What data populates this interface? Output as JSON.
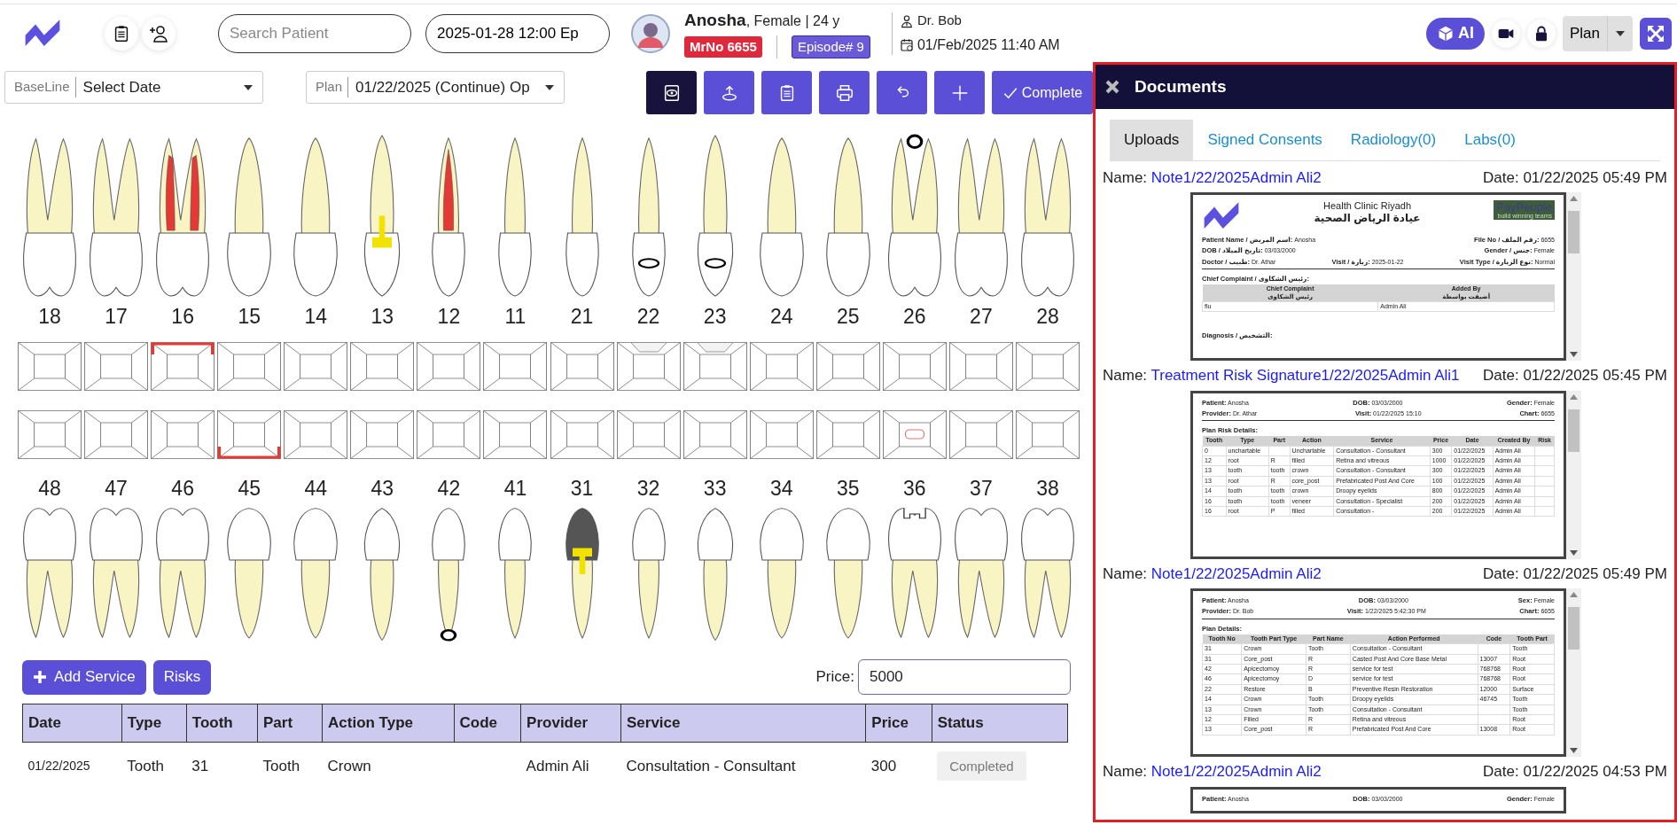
{
  "header": {
    "search": {
      "placeholder": "Search Patient"
    },
    "episode_field": {
      "value": "2025-01-28 12:00 Ep"
    },
    "patient": {
      "name": "Anosha",
      "details": ", Female | 24 y",
      "mrno": "MrNo 6655",
      "episode": "Episode# 9"
    },
    "doctor": "Dr. Bob",
    "visit_time": "01/Feb/2025 11:40 AM",
    "ai_button": "AI",
    "plan_button": "Plan"
  },
  "filters": [
    {
      "label": "BaseLine",
      "value": "Select Date"
    },
    {
      "label": "Plan",
      "value": "01/22/2025 (Continue) Op"
    }
  ],
  "toolbar": [
    {
      "kind": "eye",
      "selected": true
    },
    {
      "kind": "upload",
      "selected": false
    },
    {
      "kind": "clipboard",
      "selected": false
    },
    {
      "kind": "print",
      "selected": false
    },
    {
      "kind": "undo",
      "selected": false
    },
    {
      "kind": "plus",
      "selected": false
    },
    {
      "kind": "complete",
      "label": "Complete",
      "selected": false
    }
  ],
  "upper_teeth": [
    {
      "number": "18",
      "kind": "molar"
    },
    {
      "number": "17",
      "kind": "molar"
    },
    {
      "number": "16",
      "kind": "molar",
      "root_canal": true,
      "surface_top": true
    },
    {
      "number": "15",
      "kind": "premolar"
    },
    {
      "number": "14",
      "kind": "premolar"
    },
    {
      "number": "13",
      "kind": "canine",
      "post": true
    },
    {
      "number": "12",
      "kind": "incisor",
      "root_canal": true
    },
    {
      "number": "11",
      "kind": "incisor"
    },
    {
      "number": "21",
      "kind": "incisor"
    },
    {
      "number": "22",
      "kind": "incisor",
      "restored": true,
      "surface_notch": true
    },
    {
      "number": "23",
      "kind": "canine",
      "restored": true,
      "surface_notch": true
    },
    {
      "number": "24",
      "kind": "premolar"
    },
    {
      "number": "25",
      "kind": "premolar"
    },
    {
      "number": "26",
      "kind": "molar",
      "apex_circle": true
    },
    {
      "number": "27",
      "kind": "molar"
    },
    {
      "number": "28",
      "kind": "molar"
    }
  ],
  "lower_teeth": [
    {
      "number": "48",
      "kind": "molar"
    },
    {
      "number": "47",
      "kind": "molar"
    },
    {
      "number": "46",
      "kind": "molar"
    },
    {
      "number": "45",
      "kind": "premolar",
      "surface_bottom": true
    },
    {
      "number": "44",
      "kind": "premolar"
    },
    {
      "number": "43",
      "kind": "canine"
    },
    {
      "number": "42",
      "kind": "incisor",
      "apex_circle": true
    },
    {
      "number": "41",
      "kind": "incisor"
    },
    {
      "number": "31",
      "kind": "incisor",
      "crown": true,
      "post": true
    },
    {
      "number": "32",
      "kind": "incisor"
    },
    {
      "number": "33",
      "kind": "canine"
    },
    {
      "number": "34",
      "kind": "premolar"
    },
    {
      "number": "35",
      "kind": "premolar"
    },
    {
      "number": "36",
      "kind": "molar",
      "occlusal_restore": true,
      "surface_center": true
    },
    {
      "number": "37",
      "kind": "molar"
    },
    {
      "number": "38",
      "kind": "molar"
    }
  ],
  "service_bar": {
    "add_service": "Add Service",
    "risks": "Risks",
    "price_label": "Price:",
    "price_value": "5000"
  },
  "table": {
    "columns": [
      "Date",
      "Type",
      "Tooth",
      "Part",
      "Action Type",
      "Code",
      "Provider",
      "Service",
      "Price",
      "Status"
    ],
    "rows": [
      [
        "01/22/2025",
        "Tooth",
        "31",
        "Tooth",
        "Crown",
        null,
        "Admin Ali",
        "Consultation - Consultant",
        "300",
        "Completed"
      ]
    ]
  },
  "documents_panel": {
    "title": "Documents",
    "tabs": [
      {
        "label": "Uploads",
        "selected": true
      },
      {
        "label": "Signed Consents",
        "selected": false
      },
      {
        "label": "Radiology(0)",
        "selected": false
      },
      {
        "label": "Labs(0)",
        "selected": false
      }
    ],
    "documents": [
      {
        "name_label": "Name:",
        "name": "Note1/22/2025Admin Ali2",
        "date": "Date: 01/22/2025 05:49 PM",
        "preview": {
          "clinic": {
            "name": "Health Clinic Riyadh",
            "name_ar": "عيادة الرياض الصحية",
            "partner_logo": "PayPeople",
            "partner_tagline": "build winning teams"
          },
          "fields": [
            [
              {
                "label": "Patient Name / اسم المريض:",
                "value": "Anosha"
              },
              {
                "label": "File No / رقم الملف:",
                "value": "6655"
              }
            ],
            [
              {
                "label": "DOB / تاريخ الميلاد:",
                "value": "03/03/2000"
              },
              {
                "label": "Gender / جنس:",
                "value": "Female"
              }
            ],
            [
              {
                "label": "Doctor / طبيب:",
                "value": "Dr. Athar"
              },
              {
                "label": "Visit / زيارة:",
                "value": "2025-01-22"
              },
              {
                "label": "Visit Type / نوع الزيارة:",
                "value": "Normal"
              }
            ]
          ],
          "section": "Chief Complaint / رئيس الشكاوى:",
          "columns": [
            {
              "label": "Chief Complaint",
              "sub": "رئيس الشكاوى"
            },
            {
              "label": "Added By",
              "sub": "أضيفت بواسطة"
            }
          ],
          "rows": [
            [
              "flu",
              "Admin Ali"
            ]
          ],
          "footer_section": "Diagnosis / التشخيص:"
        }
      },
      {
        "name_label": "Name:",
        "name": "Treatment Risk Signature1/22/2025Admin Ali1",
        "date": "Date: 01/22/2025 05:45 PM",
        "preview": {
          "fields": [
            [
              {
                "label": "Patient:",
                "value": "Anosha"
              },
              {
                "label": "DOB:",
                "value": "03/03/2000"
              },
              {
                "label": "Gender:",
                "value": "Female"
              }
            ],
            [
              {
                "label": "Provider:",
                "value": "Dr. Athar"
              },
              {
                "label": "Visit:",
                "value": "01/22/2025 15:10"
              },
              {
                "label": "Chart:",
                "value": "6655"
              }
            ]
          ],
          "section": "Plan Risk Details:",
          "columns": [
            {
              "label": "Tooth"
            },
            {
              "label": "Type"
            },
            {
              "label": "Part"
            },
            {
              "label": "Action"
            },
            {
              "label": "Service"
            },
            {
              "label": "Price"
            },
            {
              "label": "Date"
            },
            {
              "label": "Created By"
            },
            {
              "label": "Risk"
            }
          ],
          "rows": [
            [
              "0",
              "unchartable",
              null,
              "Unchartable",
              "Consultation - Consultant",
              "300",
              "01/22/2025",
              "Admin Ali",
              null
            ],
            [
              "12",
              "root",
              "R",
              "filled",
              "Retina and vitreous",
              "1000",
              "01/22/2025",
              "Admin Ali",
              null
            ],
            [
              "13",
              "tooth",
              "tooth",
              "crown",
              "Consultation - Consultant",
              "300",
              "01/22/2025",
              "Admin Ali",
              null
            ],
            [
              "13",
              "root",
              "R",
              "core_post",
              "Prefabricated Post And Core",
              "100",
              "01/22/2025",
              "Admin Ali",
              null
            ],
            [
              "14",
              "tooth",
              "tooth",
              "crown",
              "Droopy eyelids",
              "800",
              "01/22/2025",
              "Admin Ali",
              null
            ],
            [
              "16",
              "tooth",
              "tooth",
              "veneer",
              "Consultation - Specialist",
              "200",
              "01/22/2025",
              "Admin Ali",
              null
            ],
            [
              "16",
              "root",
              "P",
              "filled",
              "Consultation -",
              "200",
              "01/22/2025",
              "Admin Ali",
              null
            ]
          ]
        }
      },
      {
        "name_label": "Name:",
        "name": "Note1/22/2025Admin Ali2",
        "date": "Date: 01/22/2025 05:49 PM",
        "preview": {
          "fields": [
            [
              {
                "label": "Patient:",
                "value": "Anosha"
              },
              {
                "label": "DOB:",
                "value": "03/03/2000"
              },
              {
                "label": "Sex:",
                "value": "Female"
              }
            ],
            [
              {
                "label": "Provider:",
                "value": "Dr. Bob"
              },
              {
                "label": "Visit:",
                "value": "1/22/2025 5:42:30 PM"
              },
              {
                "label": "Chart:",
                "value": "6655"
              }
            ]
          ],
          "section": "Plan Details:",
          "columns": [
            {
              "label": "Tooth No"
            },
            {
              "label": "Tooth Part Type"
            },
            {
              "label": "Part Name"
            },
            {
              "label": "Action Performed"
            },
            {
              "label": "Code"
            },
            {
              "label": "Tooth Part"
            }
          ],
          "rows": [
            [
              "31",
              "Crown",
              "Tooth",
              "Consultation - Consultant",
              null,
              "Tooth"
            ],
            [
              "31",
              "Core_post",
              "R",
              "Casted Post And Core Base Metal",
              "13007",
              "Root"
            ],
            [
              "42",
              "Apicectomoy",
              "R",
              "service for test",
              "768768",
              "Root"
            ],
            [
              "46",
              "Apicectomoy",
              "D",
              "service for test",
              "768768",
              "Root"
            ],
            [
              "22",
              "Restore",
              "B",
              "Preventive Resin Restoration",
              "12000",
              "Surface"
            ],
            [
              "14",
              "Crown",
              "Tooth",
              "Droopy eyelids",
              "46745",
              "Tooth"
            ],
            [
              "13",
              "Crown",
              "Tooth",
              "Consultation - Consultant",
              null,
              "Tooth"
            ],
            [
              "12",
              "Filled",
              "R",
              "Retina and vitreous",
              null,
              "Root"
            ],
            [
              "13",
              "Core_post",
              "R",
              "Prefabricated Post And Core",
              "13008",
              "Root"
            ]
          ]
        }
      },
      {
        "name_label": "Name:",
        "name": "Note1/22/2025Admin Ali2",
        "date": "Date: 01/22/2025 04:53 PM",
        "preview": {
          "fields": [
            [
              {
                "label": "Patient:",
                "value": "Anosha"
              },
              {
                "label": "DOB:",
                "value": "03/03/2000"
              },
              {
                "label": "Gender:",
                "value": "Female"
              }
            ]
          ]
        }
      }
    ]
  }
}
